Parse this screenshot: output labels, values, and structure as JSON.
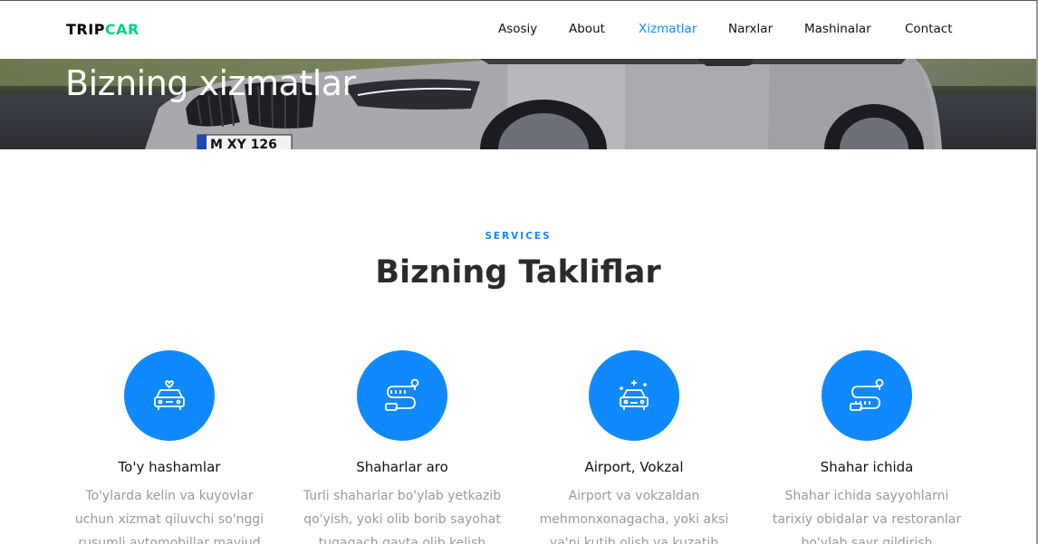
{
  "brand": {
    "part1": "TRIP",
    "part2": "CAR",
    "accent": "#01d28e"
  },
  "nav": {
    "items": [
      "Asosiy",
      "About",
      "Xizmatlar",
      "Narxlar",
      "Mashinalar",
      "Contact"
    ],
    "active": "Xizmatlar",
    "active_color": "#1089ff"
  },
  "hero": {
    "title": "Bizning xizmatlar",
    "plate_text": "M XY 126"
  },
  "services_section": {
    "subheading": "SERVICES",
    "heading": "Bizning Takliflar",
    "icon_bg": "#1089ff",
    "items": [
      {
        "title": "To'y hashamlar",
        "icon": "wedding-car-icon",
        "lines": [
          "To'ylarda kelin va kuyovlar",
          "uchun xizmat qiluvchi so'nggi",
          "rusumli avtomobillar mavjud"
        ]
      },
      {
        "title": "Shaharlar aro",
        "icon": "route-icon",
        "lines": [
          "Turli shaharlar bo'ylab yetkazib",
          "qo'yish, yoki olib borib sayohat",
          "tugagach qayta olib kelish"
        ]
      },
      {
        "title": "Airport, Vokzal",
        "icon": "shiny-car-icon",
        "lines": [
          "Airport va vokzaldan",
          "mehmonxonagacha, yoki aksi",
          "ya'ni kutib olish va kuzatib"
        ]
      },
      {
        "title": "Shahar ichida",
        "icon": "city-route-icon",
        "lines": [
          "Shahar ichida sayyohlarni",
          "tarixiy obidalar va restoranlar",
          "bo'ylab sayr qildirish"
        ]
      }
    ]
  }
}
